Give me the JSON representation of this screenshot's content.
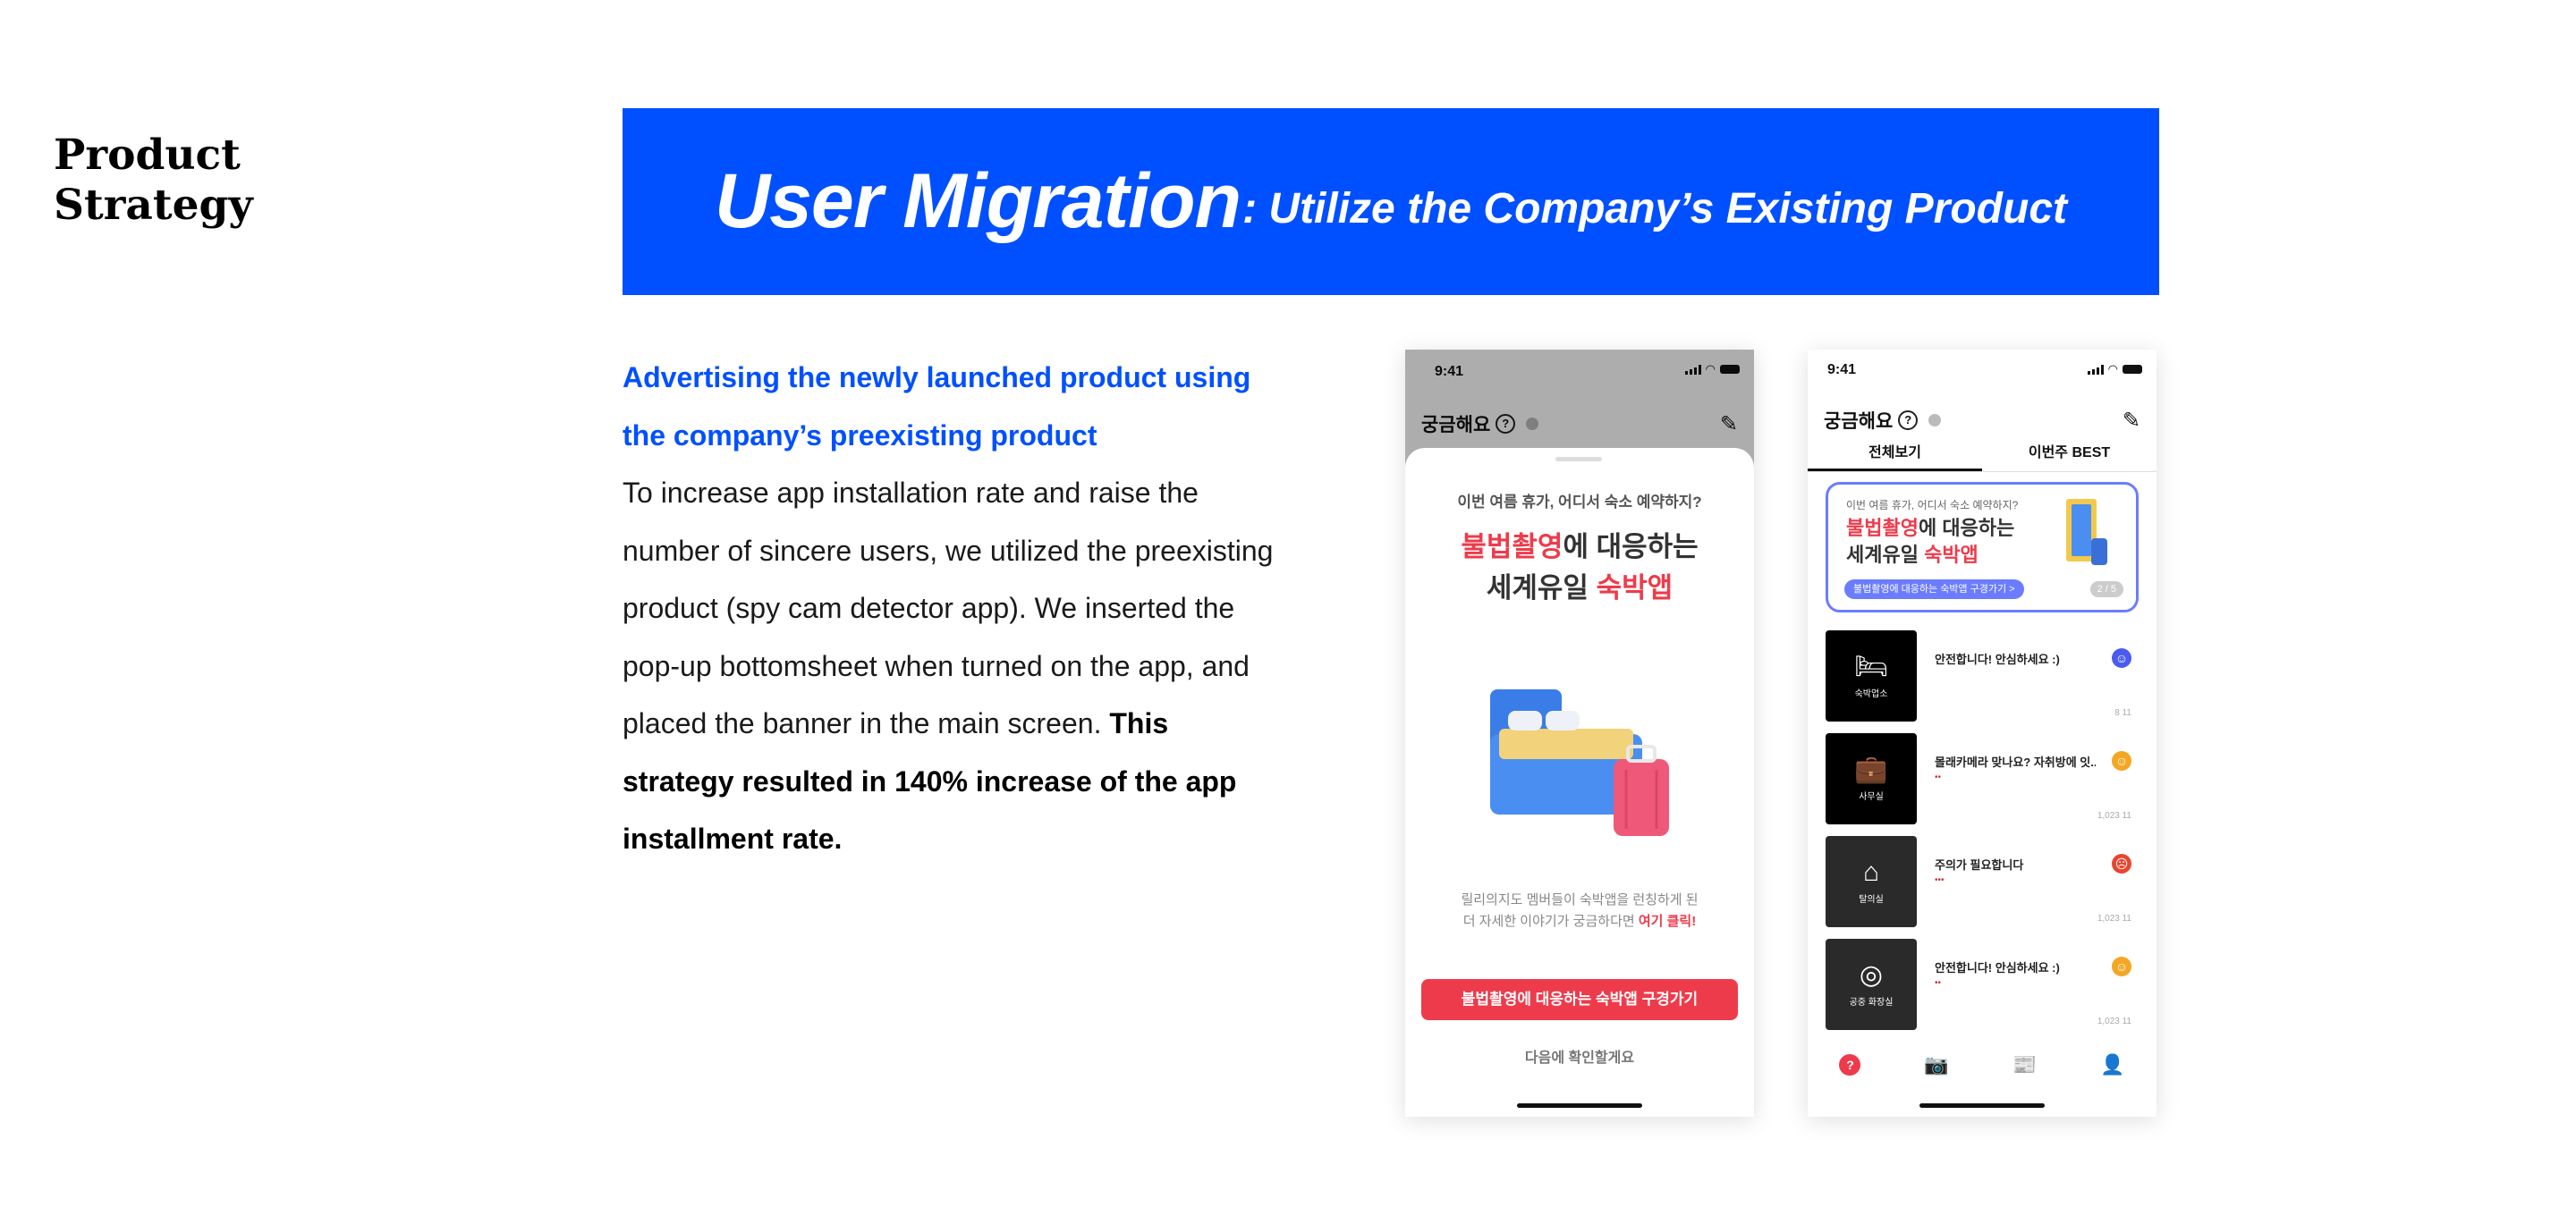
{
  "section_title": [
    "Product",
    "Strategy"
  ],
  "banner": {
    "main": "User Migration",
    "sub": ": Utilize the Company’s Existing Product",
    "color": "#0050ff"
  },
  "text": {
    "lead": "Advertising the newly launched product using the company’s preexisting product",
    "body": "To increase app installation rate and raise the number of sincere users, we utilized the preexisting product (spy cam detector app). We inserted the pop-up bottomsheet when turned on the app, and placed the banner in the main screen.",
    "emphasis": "This strategy resulted in 140% increase of the app installment rate."
  },
  "phone_common": {
    "time": "9:41",
    "app_title": "궁금해요",
    "help_glyph": "?",
    "tab_all": "전체보기",
    "tab_best": "이번주 BEST"
  },
  "sheet": {
    "question": "이번 여름 휴가, 어디서 숙소 예약하지?",
    "headline_red": "불법촬영",
    "headline_rest": "에 대응하는",
    "headline2_black": "세계유일 ",
    "headline2_red": "숙박앱",
    "desc1": "릴리의지도 멤버들이 숙박앱을 런칭하게 된",
    "desc2": "더 자세한 이야기가 궁금하다면 ",
    "desc_link": "여기 클릭!",
    "cta": "불법촬영에 대응하는 숙박앱 구경가기",
    "later": "다음에 확인할게요"
  },
  "promo": {
    "question": "이번 여름 휴가, 어디서 숙소 예약하지?",
    "headline_red": "불법촬영",
    "headline_rest": "에 대응하는",
    "headline2_black": "세계유일 ",
    "headline2_red": "숙박앱",
    "pill": "불법촬영에 대응하는 숙박앱 구경가기 >",
    "page": "2 / 5"
  },
  "reviews": [
    {
      "label": "숙박업소",
      "title": "안전합니다! 안심하세요 :)",
      "meta": "",
      "counts": "8  11",
      "face": "good"
    },
    {
      "label": "사무실",
      "title": "몰래카메라 맞나요? 자취방에 잇...",
      "meta": "••",
      "counts": "1,023  11",
      "face": "meh"
    },
    {
      "label": "탈의실",
      "title": "주의가 필요합니다",
      "meta": "•••",
      "counts": "1,023  11",
      "face": "bad"
    },
    {
      "label": "공중 화장실",
      "title": "안전합니다! 안심하세요 :)",
      "meta": "••",
      "counts": "1,023  11",
      "face": "meh"
    }
  ],
  "colors": {
    "accent_red": "#ee3b4b",
    "promo_blue": "#6b7cff",
    "face_good": "#4a5cf0",
    "face_meh": "#f5a623",
    "face_bad": "#e8452f"
  }
}
